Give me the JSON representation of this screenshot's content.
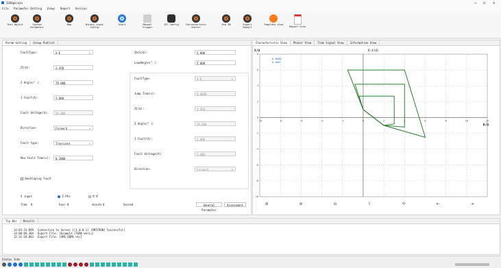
{
  "window": {
    "title": "ISPOperate",
    "controls": [
      "–",
      "▫",
      "✕"
    ]
  },
  "menu": [
    "File",
    "Parameter Setting",
    "Views",
    "Report",
    "Version"
  ],
  "toolbar": [
    {
      "label": "Test Object",
      "icon": "test-object-icon",
      "style": "ring"
    },
    {
      "label": "System\nParameter",
      "icon": "system-parameter-icon",
      "style": "ring"
    },
    {
      "label": "Map",
      "icon": "map-icon",
      "style": "ring"
    },
    {
      "label": "Binary input\nConfig",
      "icon": "binary-input-icon",
      "style": "ring"
    },
    {
      "label": "Start",
      "icon": "start-icon",
      "style": "blue"
    },
    {
      "label": "Manual\nTrigger",
      "icon": "manual-trigger-icon",
      "style": "gray"
    },
    {
      "label": "IEC Config",
      "icon": "iec-config-icon",
      "style": "gear"
    },
    {
      "label": "Characteristic\nEditor",
      "icon": "characteristic-editor-icon",
      "style": "ring"
    },
    {
      "label": "Ana IN",
      "icon": "ana-in-icon",
      "style": "ring"
    },
    {
      "label": "Export\nReport",
      "icon": "export-report-icon",
      "style": "ring"
    },
    {
      "label": "Template View",
      "icon": "template-view-icon",
      "style": "orange"
    },
    {
      "label": "Report View",
      "icon": "report-view-icon",
      "style": "doc"
    }
  ],
  "left_tabs": [
    "Param-Setting",
    "Group Publish"
  ],
  "left_form": [
    {
      "label": "FaultType:",
      "value": "A-E",
      "type": "dropdown"
    },
    {
      "label": "Z1(Ω):",
      "value": "2.450",
      "type": "input"
    },
    {
      "label": "Z Angle(° ):",
      "value": "78.000",
      "type": "input"
    },
    {
      "label": "I Fault(A):",
      "value": "5.000",
      "type": "input"
    },
    {
      "label": "Fault Voltage(V):",
      "value": "50.000",
      "type": "disabled"
    },
    {
      "label": "Direction:",
      "value": "Forward",
      "type": "dropdown"
    },
    {
      "label": "Fault type:",
      "value": "Transient",
      "type": "dropdown"
    },
    {
      "label": "Max.Fault Time(s):",
      "value": "0.2000",
      "type": "input"
    }
  ],
  "right_form_top": [
    {
      "label": "Zbrk(Ω):",
      "value": "5.000"
    },
    {
      "label": "LoadAngle(° ):",
      "value": "5.000"
    }
  ],
  "right_form": [
    {
      "label": "FaultType:",
      "value": "A-B",
      "type": "dropdown"
    },
    {
      "label": "Jump Time(s):",
      "value": "0.0000",
      "type": "input"
    },
    {
      "label": "Z1(Ω):",
      "value": "2.450",
      "type": "input"
    },
    {
      "label": "Z Angle(° ):",
      "value": "78.000",
      "type": "input"
    },
    {
      "label": "I Fault(A):",
      "value": "5.000",
      "type": "input"
    },
    {
      "label": "Fault Voltage(V):",
      "value": "5.000",
      "type": "input"
    },
    {
      "label": "Direction:",
      "value": "Forward",
      "type": "dropdown"
    }
  ],
  "developing_fault": "Developing fault",
  "z_input": {
    "label": "Z input",
    "option1": "Z-Phi",
    "option2": "R-X"
  },
  "bottom_row": {
    "time_label": "Time",
    "time_value": "0",
    "hour_label": "hour",
    "hour_value": "0",
    "minute_label": "minute",
    "minute_value": "0",
    "second_label": "Second"
  },
  "buttons": {
    "general": "General Parameter",
    "assessment": "Assessment"
  },
  "chart_tabs": [
    "Characteristic View",
    "Phasor View",
    "Time Signal View",
    "Information View"
  ],
  "chart": {
    "ylabel": "X/Ω",
    "xlabel": "R/Ω",
    "title": "R-X(Ω)",
    "readout1": "0.0000",
    "readout2": "0.000°"
  },
  "chart_data": {
    "type": "line",
    "title": "R-X(Ω)",
    "xlabel": "R/Ω",
    "ylabel": "X/Ω",
    "xlim": [
      -10,
      12
    ],
    "ylim": [
      -10,
      8
    ],
    "xticks": [
      -10,
      -8,
      -6,
      -4,
      -2,
      0,
      2,
      4,
      6,
      8,
      10,
      12
    ],
    "yticks": [
      -10,
      -8,
      -6,
      -4,
      -2,
      0,
      2,
      4,
      6,
      8
    ],
    "series": [
      {
        "x": [
          0,
          -1.5,
          4,
          6,
          2,
          0
        ],
        "y": [
          1,
          6,
          6,
          -2.5,
          -1,
          1
        ]
      },
      {
        "x": [
          0,
          -0.8,
          4,
          4,
          2,
          0
        ],
        "y": [
          1,
          4.2,
          4.2,
          -1.2,
          -1,
          1
        ]
      },
      {
        "x": [
          0,
          -0.4,
          3,
          3,
          2,
          0
        ],
        "y": [
          1,
          2.7,
          2.7,
          -0.8,
          -1,
          1
        ]
      }
    ]
  },
  "bottom_tabs": [
    "Tip Bar",
    "Results"
  ],
  "log": [
    {
      "time": "14:03:31.099",
      "msg": "Connection to Server [[1.0.0.1] [OMICRON] Successful]"
    },
    {
      "time": "14:08:04.304",
      "msg": "Export File: [Example (TEMA mero)]"
    },
    {
      "time": "15:31:18.003",
      "msg": "Export File: [AMS QQMS etc]"
    }
  ],
  "status_bar": {
    "label": "Status Inds",
    "indicators": [
      "#555",
      "#1f6fd1",
      "#1f6fd1",
      "#1f6fd1",
      "#2bb3a6",
      "#2bb3a6",
      "#2bb3a6",
      "#2bb3a6",
      "#2bb3a6",
      "#2bb3a6",
      "#2bb3a6",
      "#2bb3a6",
      "#a01a2a",
      "#a01a2a",
      "#a01a2a",
      "#a01a2a",
      "#2bb3a6",
      "#2bb3a6",
      "#2bb3a6",
      "#2bb3a6",
      "#2bb3a6",
      "#2bb3a6",
      "#2bb3a6",
      "#2bb3a6",
      "#2bb3a6"
    ]
  }
}
